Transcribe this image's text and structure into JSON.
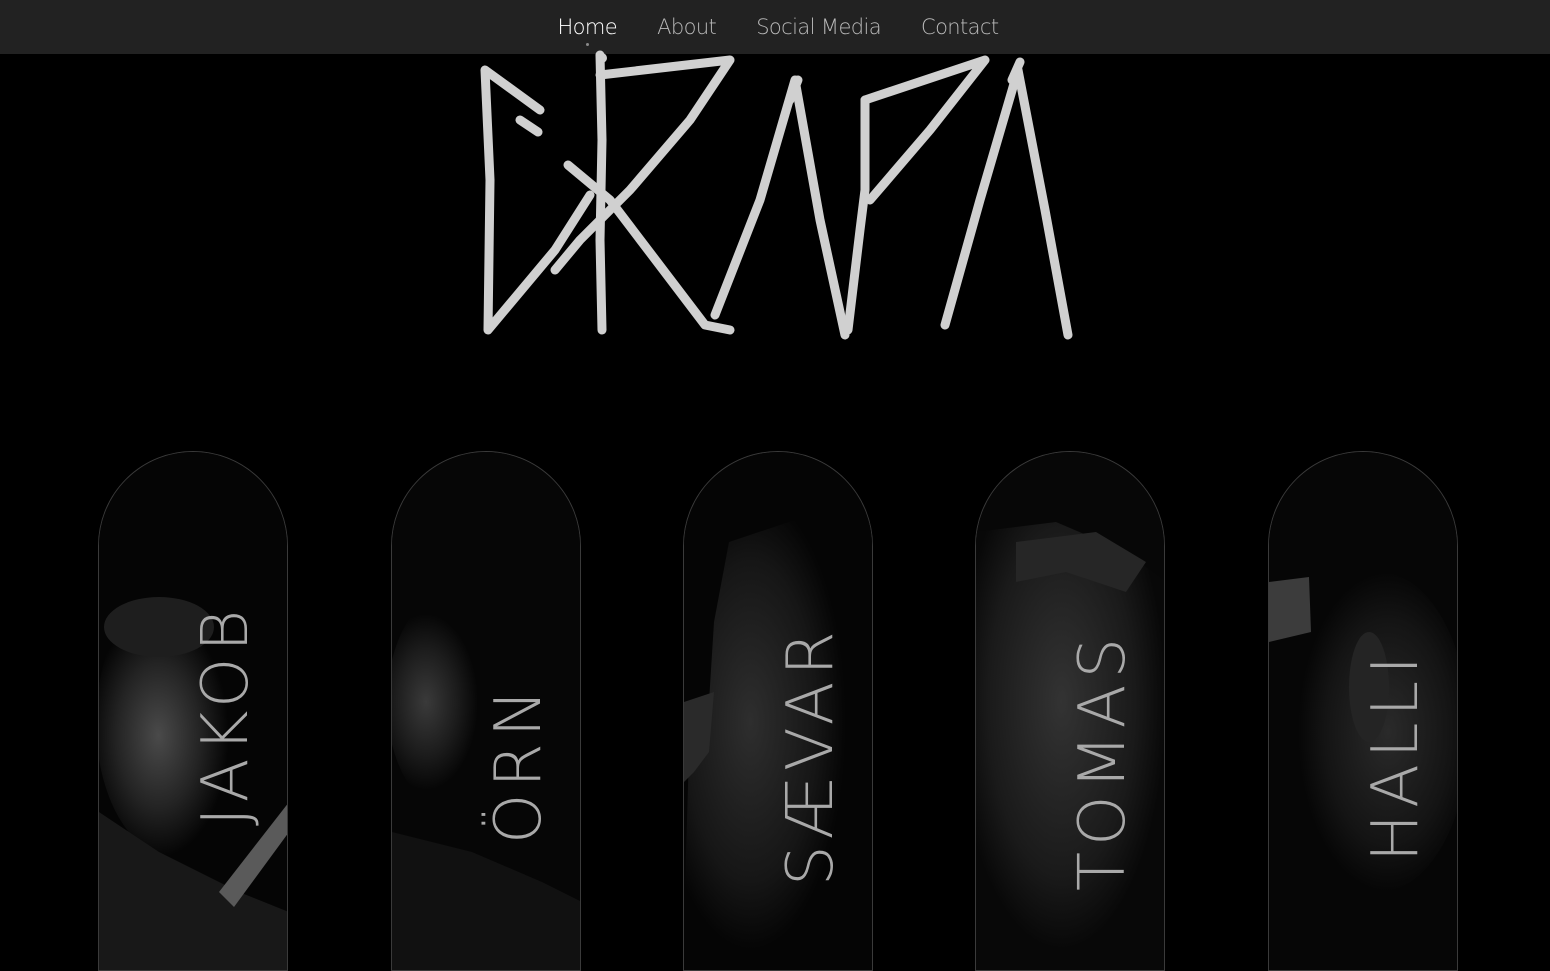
{
  "nav": {
    "items": [
      {
        "label": "Home",
        "active": true
      },
      {
        "label": "About",
        "active": false
      },
      {
        "label": "Social Media",
        "active": false
      },
      {
        "label": "Contact",
        "active": false
      }
    ]
  },
  "logo": {
    "text": "GRAPA"
  },
  "members": [
    {
      "name": "JAKOB"
    },
    {
      "name": "ÖRN"
    },
    {
      "name": "SÆVAR"
    },
    {
      "name": "TOMAS"
    },
    {
      "name": "HALLI"
    }
  ],
  "colors": {
    "background": "#000000",
    "navbar": "#222222",
    "nav_text": "#b9b9b9",
    "nav_active": "#ffffff",
    "logo": "#d0d0d0",
    "card_border": "#3a3a3a",
    "member_name": "#a9a9a9"
  }
}
